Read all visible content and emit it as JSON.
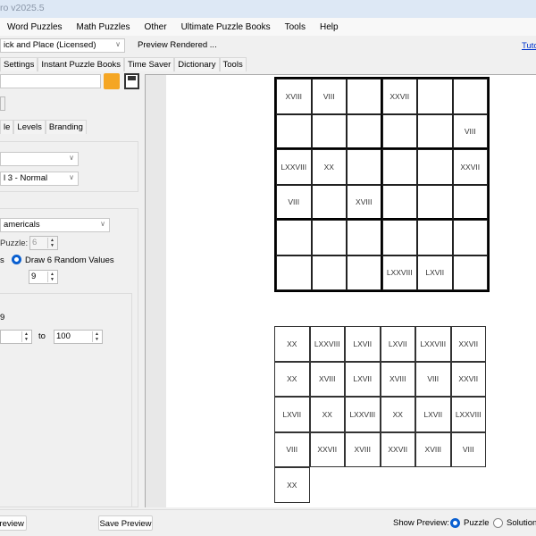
{
  "title": "ro v2025.5",
  "menu": [
    "Word Puzzles",
    "Math Puzzles",
    "Other",
    "Ultimate Puzzle Books",
    "Tools",
    "Help"
  ],
  "toolbar": {
    "puzzle_select": "ick and Place (Licensed)",
    "status": "Preview Rendered ...",
    "tutorial_link": "Tuto"
  },
  "main_tabs": [
    "Settings",
    "Instant Puzzle Books",
    "Time Saver",
    "Dictionary",
    "Tools"
  ],
  "left": {
    "file_input": "",
    "sub_tabs": [
      "le",
      "Levels",
      "Branding"
    ],
    "combo1": "",
    "level_combo": "l 3 - Normal",
    "type_combo": "americals",
    "puzzle_label": "Puzzle:",
    "puzzle_value": "6",
    "radio1_label": "s",
    "radio2_label": "Draw 6 Random Values",
    "count_value": "9",
    "range_label": "9",
    "range_from": "",
    "to_label": "to",
    "range_to": "100"
  },
  "puzzle_grid": [
    [
      "XVIII",
      "VIII",
      "",
      "XXVII",
      "",
      ""
    ],
    [
      "",
      "",
      "",
      "",
      "",
      "VIII"
    ],
    [
      "LXXVIII",
      "XX",
      "",
      "",
      "",
      "XXVII"
    ],
    [
      "VIII",
      "",
      "XVIII",
      "",
      "",
      ""
    ],
    [
      "",
      "",
      "",
      "",
      "",
      ""
    ],
    [
      "",
      "",
      "",
      "LXXVIII",
      "LXVII",
      ""
    ]
  ],
  "word_bank": [
    "XX",
    "LXXVIII",
    "LXVII",
    "LXVII",
    "LXXVIII",
    "XXVII",
    "XX",
    "XVIII",
    "LXVII",
    "XVIII",
    "VIII",
    "XXVII",
    "LXVII",
    "XX",
    "LXXVIII",
    "XX",
    "LXVII",
    "LXXVIII",
    "VIII",
    "XXVII",
    "XVIII",
    "XXVII",
    "XVIII",
    "VIII",
    "XX"
  ],
  "bottom": {
    "preview_button": "Preview",
    "save_preview": "Save Preview",
    "show_preview_label": "Show Preview:",
    "puzzle_radio": "Puzzle",
    "solution_radio": "Solution",
    "selected": "Puzzle"
  }
}
